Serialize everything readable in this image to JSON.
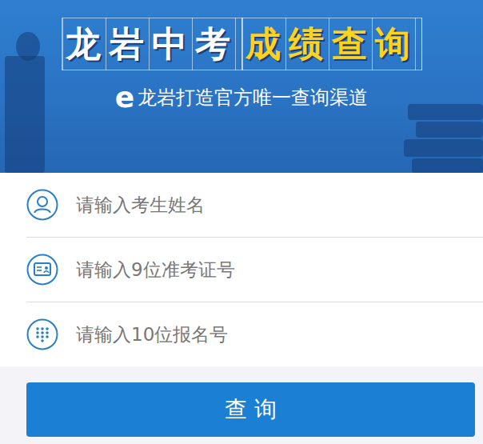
{
  "banner": {
    "title": [
      {
        "text": "龙岩中考",
        "highlight": false
      },
      {
        "text": "成绩查询",
        "highlight": true
      }
    ],
    "subtitle": {
      "logo": "e",
      "text": "龙岩打造官方唯一查询渠道"
    }
  },
  "fields": [
    {
      "kind": "person",
      "placeholder": "请输入考生姓名"
    },
    {
      "kind": "card",
      "placeholder": "请输入9位准考证号"
    },
    {
      "kind": "keypad",
      "placeholder": "请输入10位报名号"
    }
  ],
  "button": {
    "label": "查 询"
  }
}
